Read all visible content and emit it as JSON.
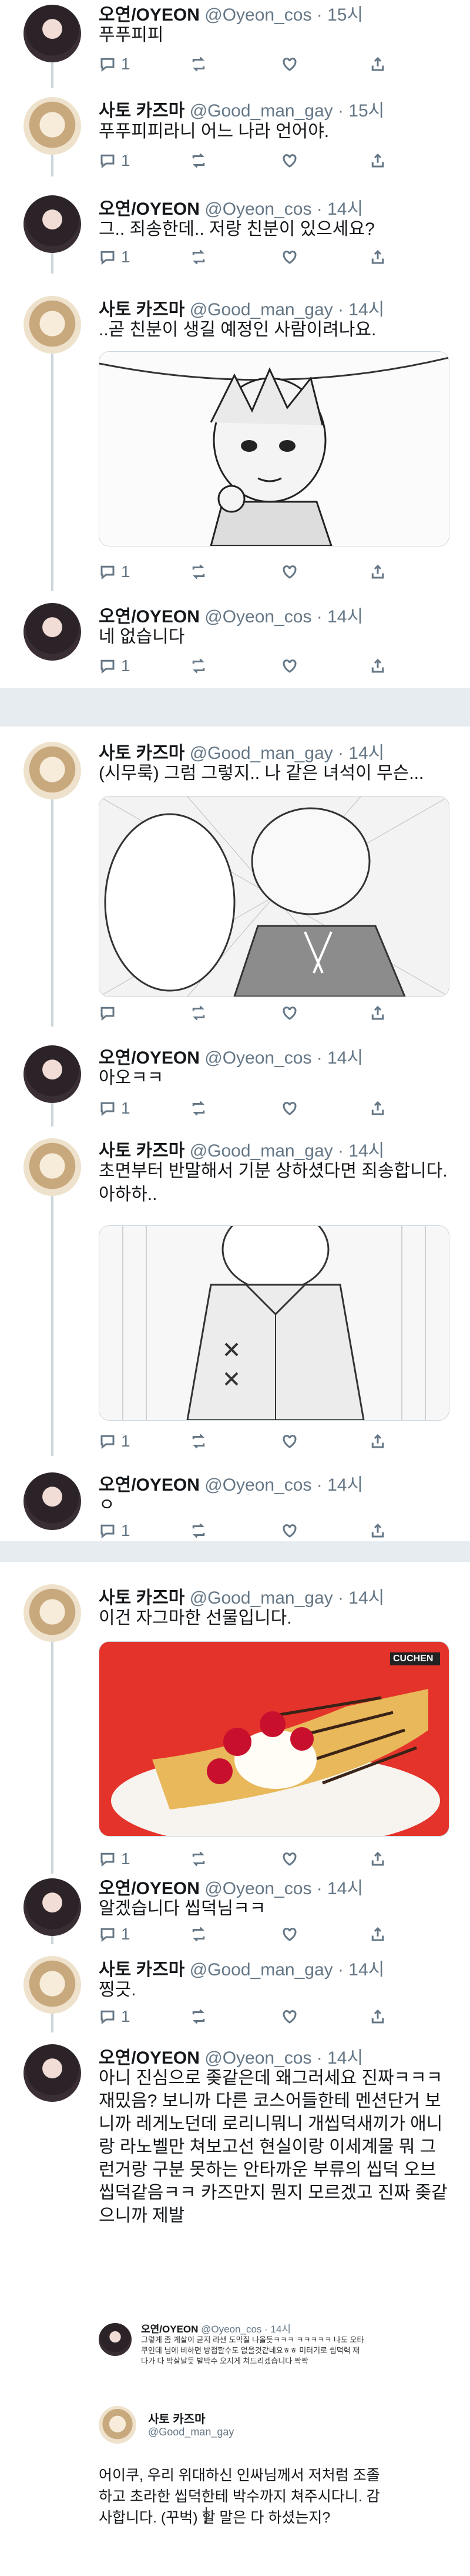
{
  "users": {
    "oyeon": {
      "name": "오연/OYEON",
      "handle": "@Oyeon_cos"
    },
    "sato": {
      "name": "사토 카즈마",
      "handle": "@Good_man_gay"
    }
  },
  "tweets": [
    {
      "time": "· 15시",
      "text": "푸푸피피",
      "reply_count": "1"
    },
    {
      "time": "· 15시",
      "text": "푸푸피피라니 어느 나라 언어야.",
      "reply_count": "1"
    },
    {
      "time": "· 14시",
      "text": "그.. 죄송한데.. 저랑 친분이 있으세요?",
      "reply_count": "1"
    },
    {
      "time": "· 14시",
      "text": "..곧 친분이 생길 예정인 사람이려나요.",
      "reply_count": "1"
    },
    {
      "time": "· 14시",
      "text": "네 없습니다",
      "reply_count": "1"
    },
    {
      "time": "· 14시",
      "text": "(시무룩) 그럼 그렇지.. 나 같은 녀석이 무슨...",
      "reply_count": ""
    },
    {
      "time": "· 14시",
      "text": "아오ㅋㅋ",
      "reply_count": "1"
    },
    {
      "time": "· 14시",
      "text": "초면부터 반말해서 기분 상하셨다면 죄송합니다. 아하하..",
      "reply_count": "1"
    },
    {
      "time": "· 14시",
      "text": "ㅇ",
      "reply_count": "1"
    },
    {
      "time": "· 14시",
      "text": "이건 자그마한 선물입니다.",
      "reply_count": "1",
      "media_label": "CUCHEN"
    },
    {
      "time": "· 14시",
      "text": "알겠습니다 씹덕님ㅋㅋ",
      "reply_count": "1"
    },
    {
      "time": "· 14시",
      "text": "찡긋.",
      "reply_count": "1"
    },
    {
      "time": "· 14시",
      "text": "아니 진심으로 좆같은데 왜그러세요 진짜ㅋㅋㅋ 재밌음? 보니까 다른 코스어들한테 멘션단거 보니까 레게노던데 로리니뭐니 개씹덕새끼가 애니랑 라노벨만 쳐보고선 현실이랑 이세계물 뭐 그런거랑 구분 못하는 안타까운 부류의 씹덕 오브 씹덕같음ㅋㅋ 카즈만지 뭔지 모르겠고 진짜 좆같으니까 제발",
      "reply_count": ""
    }
  ],
  "quote_reply": {
    "name": "오연/OYEON",
    "handle": "@Oyeon_cos · 14시",
    "text": "그렇게 좀 게살이 굳지 라샌 도막질 나올듯ㅋㅋㅋ ㅋㅋㅋㅋㅋ 나도 오타쿠인데 님에 비하면 방접할수도 없을것같네요ㅎㅎ 미터기로 씹덕력 재다가 다 박살날듯 발박수 오지게 쳐드리겠습니다 짝짝"
  },
  "final_reply": {
    "name": "사토 카즈마",
    "handle": "@Good_man_gay",
    "text": "어이쿠, 우리 위대하신 인싸님께서 저처럼 조졸하고 초라한 씹덕한테 박수까지 쳐주시다니. 감사합니다. (꾸벅) 할 말은 다 하셨는지?"
  }
}
